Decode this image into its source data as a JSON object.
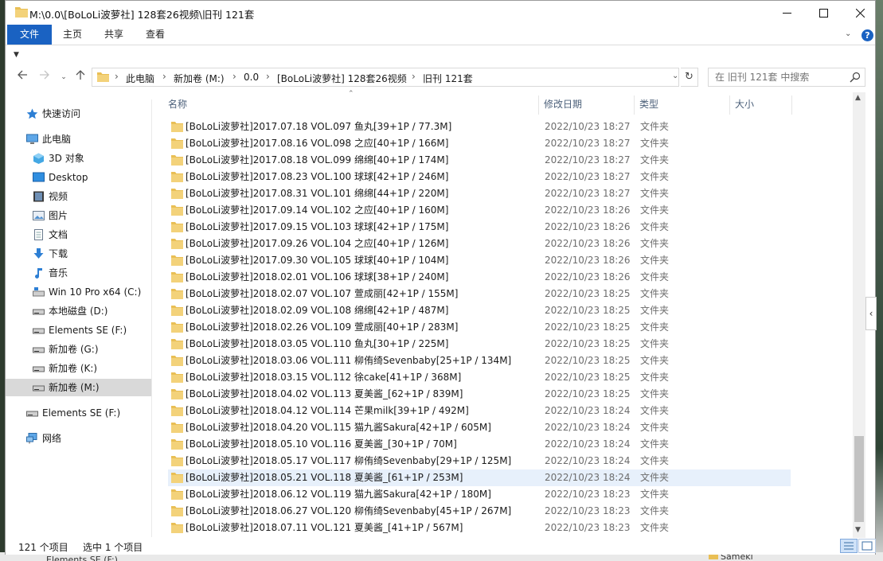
{
  "window": {
    "title": "M:\\0.0\\[BoLoLi波萝社] 128套26视频\\旧刊 121套"
  },
  "ribbon": {
    "tabs": [
      "文件",
      "主页",
      "共享",
      "查看"
    ],
    "help": "?"
  },
  "nav": {
    "breadcrumbs": [
      "此电脑",
      "新加卷 (M:)",
      "0.0",
      "[BoLoLi波萝社] 128套26视频",
      "旧刊 121套"
    ],
    "search_placeholder": "在 旧刊 121套 中搜索"
  },
  "sidebar": {
    "items": [
      {
        "label": "快速访问",
        "icon": "star-icon"
      },
      {
        "label": "此电脑",
        "icon": "computer-icon"
      },
      {
        "label": "3D 对象",
        "icon": "3d-objects-icon"
      },
      {
        "label": "Desktop",
        "icon": "desktop-icon"
      },
      {
        "label": "视频",
        "icon": "video-icon"
      },
      {
        "label": "图片",
        "icon": "pictures-icon"
      },
      {
        "label": "文档",
        "icon": "documents-icon"
      },
      {
        "label": "下载",
        "icon": "download-icon"
      },
      {
        "label": "音乐",
        "icon": "music-icon"
      },
      {
        "label": "Win 10 Pro x64 (C:)",
        "icon": "drive-c-icon"
      },
      {
        "label": "本地磁盘 (D:)",
        "icon": "drive-icon"
      },
      {
        "label": "Elements SE (F:)",
        "icon": "drive-icon"
      },
      {
        "label": "新加卷 (G:)",
        "icon": "drive-icon"
      },
      {
        "label": "新加卷 (K:)",
        "icon": "drive-icon"
      },
      {
        "label": "新加卷 (M:)",
        "icon": "drive-icon"
      },
      {
        "label": "Elements SE (F:)",
        "icon": "drive-icon"
      },
      {
        "label": "网络",
        "icon": "network-icon"
      }
    ]
  },
  "columns": [
    "名称",
    "修改日期",
    "类型",
    "大小"
  ],
  "files": [
    {
      "name": "[BoLoLi波萝社]2017.07.18 VOL.097 鱼丸[39+1P / 77.3M]",
      "date": "2022/10/23 18:27",
      "type": "文件夹"
    },
    {
      "name": "[BoLoLi波萝社]2017.08.16 VOL.098 之应[40+1P / 166M]",
      "date": "2022/10/23 18:27",
      "type": "文件夹"
    },
    {
      "name": "[BoLoLi波萝社]2017.08.18 VOL.099 绵绵[40+1P / 174M]",
      "date": "2022/10/23 18:27",
      "type": "文件夹"
    },
    {
      "name": "[BoLoLi波萝社]2017.08.23 VOL.100 球球[42+1P / 246M]",
      "date": "2022/10/23 18:27",
      "type": "文件夹"
    },
    {
      "name": "[BoLoLi波萝社]2017.08.31 VOL.101 绵绵[44+1P / 220M]",
      "date": "2022/10/23 18:27",
      "type": "文件夹"
    },
    {
      "name": "[BoLoLi波萝社]2017.09.14 VOL.102 之应[40+1P / 160M]",
      "date": "2022/10/23 18:26",
      "type": "文件夹"
    },
    {
      "name": "[BoLoLi波萝社]2017.09.15 VOL.103 球球[42+1P / 175M]",
      "date": "2022/10/23 18:26",
      "type": "文件夹"
    },
    {
      "name": "[BoLoLi波萝社]2017.09.26 VOL.104 之应[40+1P / 126M]",
      "date": "2022/10/23 18:26",
      "type": "文件夹"
    },
    {
      "name": "[BoLoLi波萝社]2017.09.30 VOL.105 球球[40+1P / 104M]",
      "date": "2022/10/23 18:26",
      "type": "文件夹"
    },
    {
      "name": "[BoLoLi波萝社]2018.02.01 VOL.106 球球[38+1P / 240M]",
      "date": "2022/10/23 18:26",
      "type": "文件夹"
    },
    {
      "name": "[BoLoLi波萝社]2018.02.07 VOL.107 萱成丽[42+1P / 155M]",
      "date": "2022/10/23 18:25",
      "type": "文件夹"
    },
    {
      "name": "[BoLoLi波萝社]2018.02.09 VOL.108 绵绵[42+1P / 487M]",
      "date": "2022/10/23 18:25",
      "type": "文件夹"
    },
    {
      "name": "[BoLoLi波萝社]2018.02.26 VOL.109 萱成丽[40+1P / 283M]",
      "date": "2022/10/23 18:25",
      "type": "文件夹"
    },
    {
      "name": "[BoLoLi波萝社]2018.03.05 VOL.110 鱼丸[30+1P / 225M]",
      "date": "2022/10/23 18:25",
      "type": "文件夹"
    },
    {
      "name": "[BoLoLi波萝社]2018.03.06 VOL.111 柳侑绮Sevenbaby[25+1P / 134M]",
      "date": "2022/10/23 18:25",
      "type": "文件夹"
    },
    {
      "name": "[BoLoLi波萝社]2018.03.15 VOL.112 徐cake[41+1P / 368M]",
      "date": "2022/10/23 18:25",
      "type": "文件夹"
    },
    {
      "name": "[BoLoLi波萝社]2018.04.02 VOL.113 夏美酱_[62+1P / 839M]",
      "date": "2022/10/23 18:25",
      "type": "文件夹"
    },
    {
      "name": "[BoLoLi波萝社]2018.04.12 VOL.114 芒果milk[39+1P / 492M]",
      "date": "2022/10/23 18:24",
      "type": "文件夹"
    },
    {
      "name": "[BoLoLi波萝社]2018.04.20 VOL.115 猫九酱Sakura[42+1P / 605M]",
      "date": "2022/10/23 18:24",
      "type": "文件夹"
    },
    {
      "name": "[BoLoLi波萝社]2018.05.10 VOL.116 夏美酱_[30+1P / 70M]",
      "date": "2022/10/23 18:24",
      "type": "文件夹"
    },
    {
      "name": "[BoLoLi波萝社]2018.05.17 VOL.117 柳侑绮Sevenbaby[29+1P / 125M]",
      "date": "2022/10/23 18:24",
      "type": "文件夹"
    },
    {
      "name": "[BoLoLi波萝社]2018.05.21 VOL.118 夏美酱_[61+1P / 253M]",
      "date": "2022/10/23 18:24",
      "type": "文件夹",
      "selected": true
    },
    {
      "name": "[BoLoLi波萝社]2018.06.12 VOL.119 猫九酱Sakura[42+1P / 180M]",
      "date": "2022/10/23 18:23",
      "type": "文件夹"
    },
    {
      "name": "[BoLoLi波萝社]2018.06.27 VOL.120 柳侑绮Sevenbaby[45+1P / 267M]",
      "date": "2022/10/23 18:23",
      "type": "文件夹"
    },
    {
      "name": "[BoLoLi波萝社]2018.07.11 VOL.121 夏美酱_[41+1P / 567M]",
      "date": "2022/10/23 18:23",
      "type": "文件夹"
    }
  ],
  "status": {
    "count": "121 个项目",
    "selected": "选中 1 个项目"
  },
  "desktop": {
    "bottom_left": "Elements SE (F:)",
    "bottom_right": "Sameki"
  },
  "colors": {
    "accent": "#1a62c2",
    "folder": "#e9bf55",
    "selected_row": "#e7f0fb",
    "header_text": "#4c607a"
  }
}
